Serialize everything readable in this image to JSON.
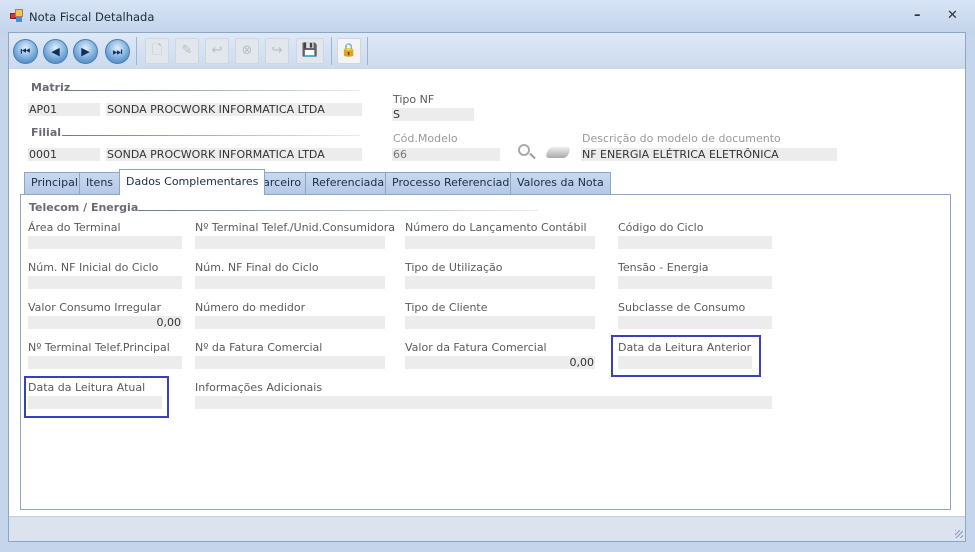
{
  "window": {
    "title": "Nota Fiscal Detalhada",
    "minimize": "–",
    "close": "✕"
  },
  "toolbar": {
    "first": "⏮",
    "prev": "◀",
    "next": "▶",
    "last": "⏭",
    "new": "🗋",
    "edit": "✎",
    "undo": "↩",
    "delete": "⊗",
    "redo": "↪",
    "save": "💾",
    "lock": "🔒"
  },
  "header": {
    "matriz_label": "Matriz",
    "matriz_code": "AP01",
    "matriz_name": "SONDA PROCWORK INFORMATICA LTDA",
    "filial_label": "Filial",
    "filial_code": "0001",
    "filial_name": "SONDA PROCWORK INFORMATICA LTDA",
    "tipo_nf_label": "Tipo NF",
    "tipo_nf": "S",
    "cod_modelo_label": "Cód.Modelo",
    "cod_modelo": "66",
    "desc_modelo_label": "Descrição do modelo de documento",
    "desc_modelo": "NF ENERGIA ELÉTRICA ELETRÔNICA"
  },
  "tabs": [
    "Principal",
    "Itens",
    "Dados Complementares",
    "Parceiro",
    "Referenciada",
    "Processo Referenciado",
    "Valores da Nota"
  ],
  "group": {
    "title": "Telecom / Energia"
  },
  "fields": [
    {
      "label": "Área do Terminal",
      "value": ""
    },
    {
      "label": "Nº Terminal Telef./Unid.Consumidora",
      "value": ""
    },
    {
      "label": "Número do Lançamento Contábil",
      "value": ""
    },
    {
      "label": "Código do Ciclo",
      "value": ""
    },
    {
      "label": "Núm. NF Inicial do Ciclo",
      "value": ""
    },
    {
      "label": "Núm. NF Final do Ciclo",
      "value": ""
    },
    {
      "label": "Tipo de Utilização",
      "value": ""
    },
    {
      "label": "Tensão - Energia",
      "value": ""
    },
    {
      "label": "Valor Consumo Irregular",
      "value": "0,00"
    },
    {
      "label": "Número do medidor",
      "value": ""
    },
    {
      "label": "Tipo de Cliente",
      "value": ""
    },
    {
      "label": "Subclasse de Consumo",
      "value": ""
    },
    {
      "label": "Nº Terminal Telef.Principal",
      "value": ""
    },
    {
      "label": "Nº da Fatura Comercial",
      "value": ""
    },
    {
      "label": "Valor da Fatura Comercial",
      "value": "0,00"
    },
    {
      "label": "Data da Leitura Anterior",
      "value": ""
    },
    {
      "label": "Data da Leitura Atual",
      "value": ""
    },
    {
      "label": "Informações Adicionais",
      "value": ""
    }
  ]
}
